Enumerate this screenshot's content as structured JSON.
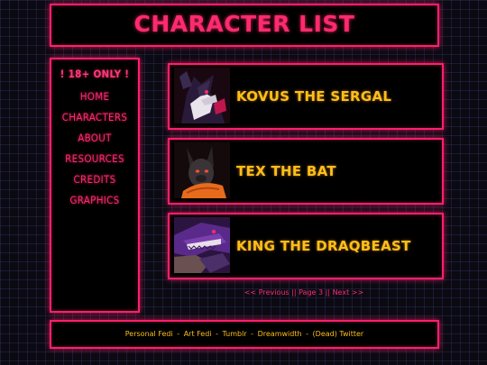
{
  "header": {
    "title": "CHARACTER LIST"
  },
  "nav": {
    "warning": "! 18+ ONLY !",
    "items": [
      "HOME",
      "CHARACTERS",
      "ABOUT",
      "RESOURCES",
      "CREDITS",
      "GRAPHICS"
    ]
  },
  "characters": [
    {
      "name": "KOVUS THE SERGAL"
    },
    {
      "name": "TEX THE BAT"
    },
    {
      "name": "KING THE DRAQBEAST"
    }
  ],
  "pagination": {
    "previous": "<< Previous",
    "sep1": "||",
    "current": "Page 3",
    "sep2": "||",
    "next": "Next >>"
  },
  "footer": {
    "links": [
      "Personal Fedi",
      "Art Fedi",
      "Tumblr",
      "Dreamwidth",
      "(Dead) Twitter"
    ],
    "separator": "-"
  },
  "colors": {
    "accent": "#ff2a6d",
    "name": "#ffbe1a",
    "panel": "#000000"
  }
}
